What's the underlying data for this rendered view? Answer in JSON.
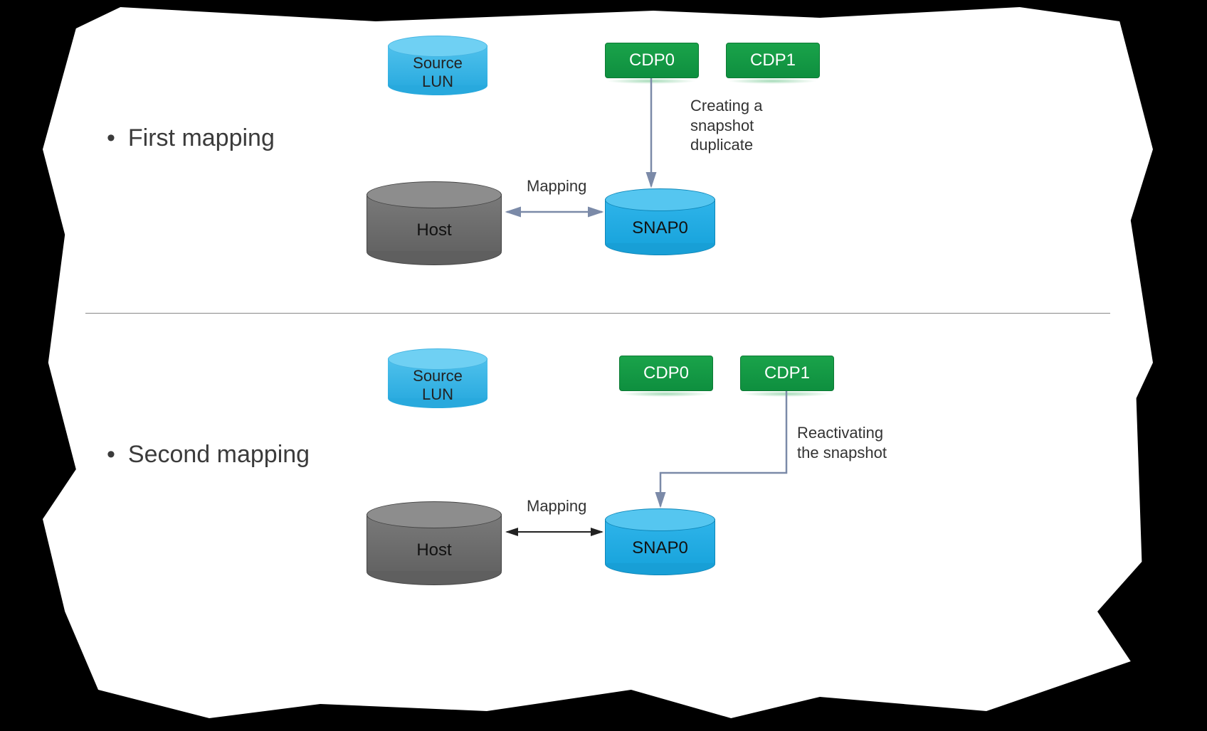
{
  "sections": {
    "first": {
      "title": "First mapping",
      "source_lun": "Source\nLUN",
      "cdp0": "CDP0",
      "cdp1": "CDP1",
      "host": "Host",
      "snap0": "SNAP0",
      "mapping_label": "Mapping",
      "note": "Creating a\nsnapshot\nduplicate"
    },
    "second": {
      "title": "Second mapping",
      "source_lun": "Source\nLUN",
      "cdp0": "CDP0",
      "cdp1": "CDP1",
      "host": "Host",
      "snap0": "SNAP0",
      "mapping_label": "Mapping",
      "note": "Reactivating\nthe snapshot"
    }
  },
  "colors": {
    "grey_top": "#7d7d7d",
    "grey_side": "#6a6a6a",
    "lightblue_top": "#5bc6ef",
    "lightblue_side": "#2fb2e8",
    "blue_top": "#37bdf2",
    "blue_side": "#1aa7e6",
    "green": "#15a049"
  }
}
